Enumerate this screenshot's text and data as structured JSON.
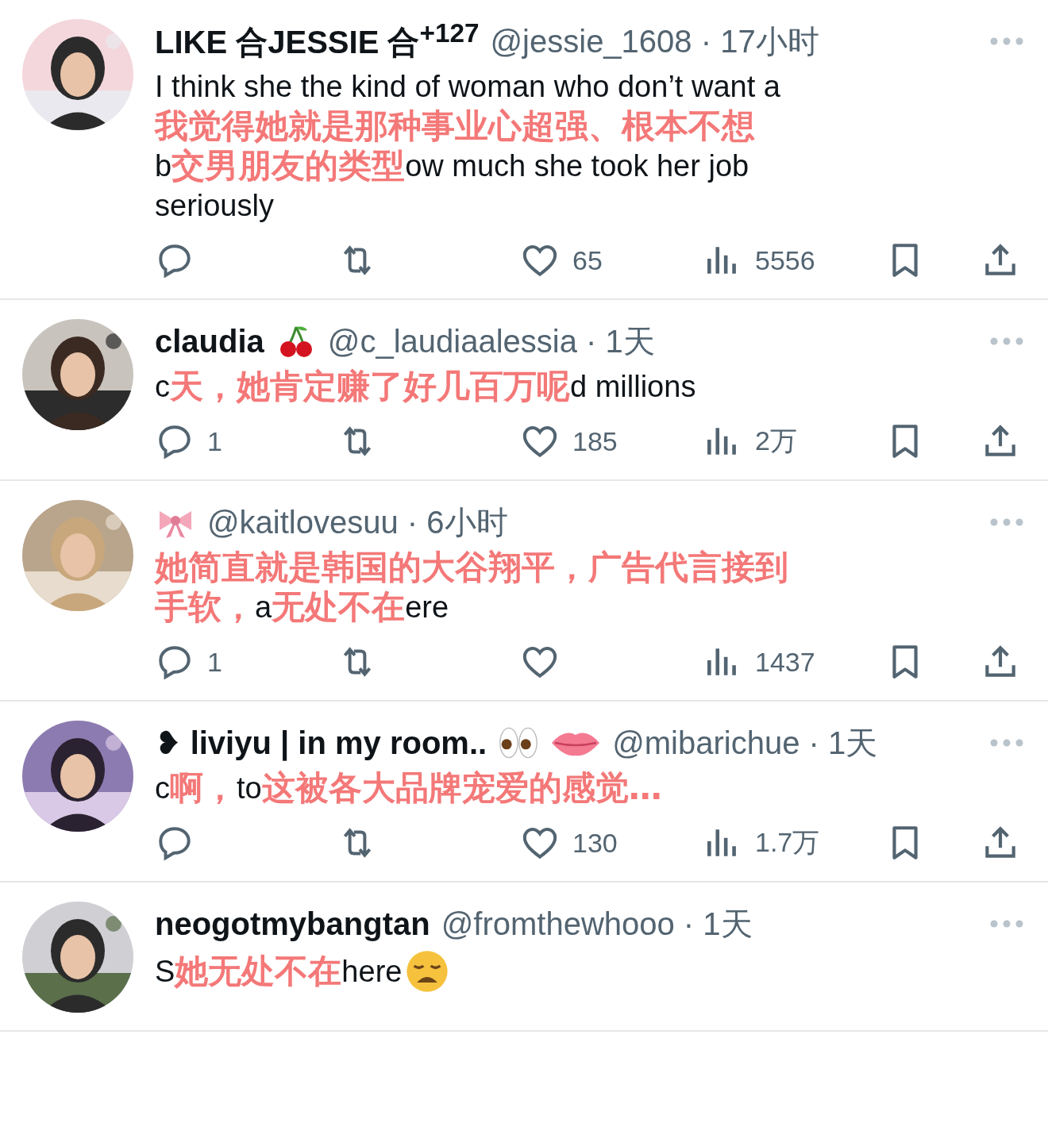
{
  "tweets": [
    {
      "name": "LIKE 合JESSIE 合$^{+127}$",
      "handle_time": "@jessie_1608 · 17小时",
      "lines": [
        [
          {
            "kind": "text",
            "text": "I think she the kind of woman who don’t want a"
          }
        ],
        [
          {
            "kind": "overlay",
            "text": "我觉得她就是那种事业心超强、根本不想"
          }
        ],
        [
          {
            "kind": "text",
            "text": "b"
          },
          {
            "kind": "overlay",
            "text": "交男朋友的类型"
          },
          {
            "kind": "text",
            "text": "ow much she took her job"
          }
        ],
        [
          {
            "kind": "text",
            "text": "seriously"
          }
        ]
      ],
      "stats": {
        "likes": "65",
        "views": "5556"
      }
    },
    {
      "name": "claudia",
      "name_emojis": [
        {
          "kind": "cherry"
        }
      ],
      "handle_time": "@c_laudiaalessia · 1天",
      "lines": [
        [
          {
            "kind": "text",
            "text": "c"
          },
          {
            "kind": "overlay",
            "text": "天，她肯定赚了好几百万呢"
          },
          {
            "kind": "text",
            "text": "d millions"
          }
        ]
      ],
      "stats": {
        "replies": "1",
        "likes": "185",
        "views": "2万"
      }
    },
    {
      "name_emojis": [
        {
          "kind": "ribbon"
        }
      ],
      "handle_time": "@kaitlovesuu · 6小时",
      "lines": [
        [
          {
            "kind": "overlay",
            "text": "她简直就是韩国的大谷翔平，广告代言接到"
          }
        ],
        [
          {
            "kind": "overlay",
            "text": "手软，"
          },
          {
            "kind": "text",
            "text": "a"
          },
          {
            "kind": "overlay",
            "text": "无处不在"
          },
          {
            "kind": "text",
            "text": "ere"
          }
        ]
      ],
      "stats": {
        "replies": "1",
        "views": "1437"
      }
    },
    {
      "name": "❥ liviyu | in my room..",
      "name_emojis": [
        {
          "kind": "eyes"
        },
        {
          "kind": "lips"
        }
      ],
      "handle_time": "@mibarichue · 1天",
      "lines": [
        [
          {
            "kind": "text",
            "text": "c"
          },
          {
            "kind": "overlay",
            "text": "啊，"
          },
          {
            "kind": "text",
            "text": "to"
          },
          {
            "kind": "overlay",
            "text": "这被各大品牌宠爱的感觉…"
          }
        ]
      ],
      "stats": {
        "likes": "130",
        "views": "1.7万"
      }
    },
    {
      "name": "neogotmybangtan",
      "handle_time": "@fromthewhooo · 1天",
      "lines": [
        [
          {
            "kind": "text",
            "text": "S"
          },
          {
            "kind": "overlay",
            "text": "她无处不在"
          },
          {
            "kind": "text",
            "text": "here"
          },
          {
            "kind": "weary-face"
          }
        ]
      ]
    }
  ]
}
